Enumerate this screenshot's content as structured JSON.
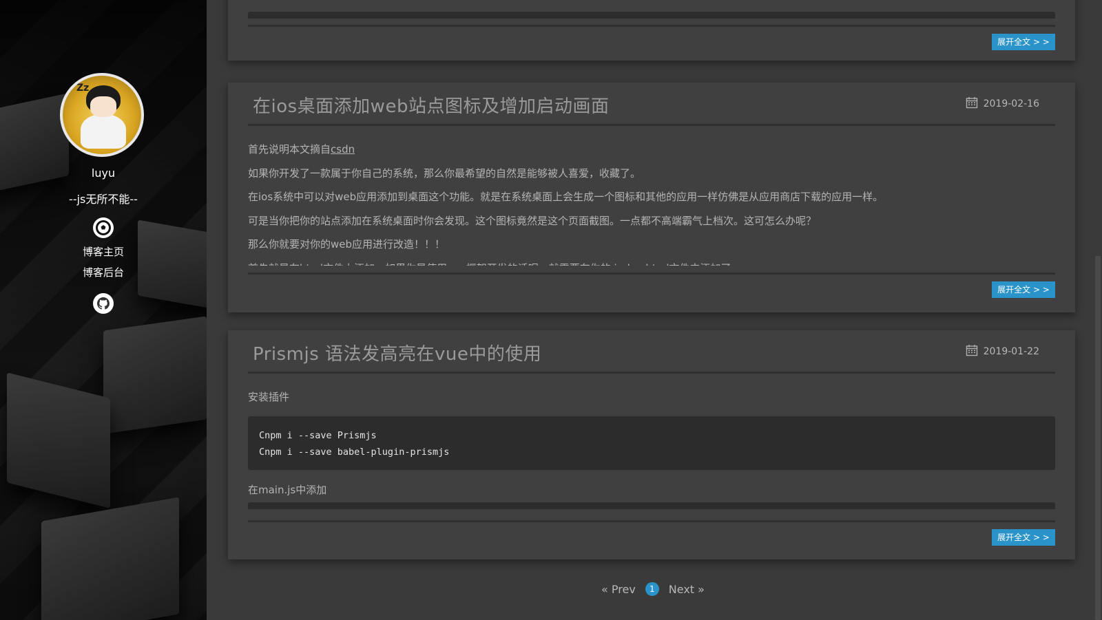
{
  "sidebar": {
    "name": "luyu",
    "motto": "--js无所不能--",
    "links": [
      {
        "label": "博客主页"
      },
      {
        "label": "博客后台"
      }
    ],
    "icons": [
      "soccer-ball-icon",
      "github-icon"
    ]
  },
  "top_card": {
    "more_label": "展开全文 > >"
  },
  "posts": [
    {
      "title": "在ios桌面添加web站点图标及增加启动画面",
      "date": "2019-02-16",
      "intro_prefix": "首先说明本文摘自",
      "intro_link": "csdn",
      "paragraphs": [
        "如果你开发了一款属于你自己的系统，那么你最希望的自然是能够被人喜爱，收藏了。",
        "在ios系统中可以对web应用添加到桌面这个功能。就是在系统桌面上会生成一个图标和其他的应用一样仿佛是从应用商店下载的应用一样。",
        "可是当你把你的站点添加在系统桌面时你会发现。这个图标竟然是这个页面截图。一点都不高端霸气上档次。这可怎么办呢？",
        "那么你就要对你的web应用进行改造！！！",
        "首先就是在html文件上添加，如果你是使用vue框架开发的话呢，就需要在你的 index.html文件中添加了"
      ],
      "more_label": "展开全文 > >"
    },
    {
      "title": "Prismjs 语法发高亮在vue中的使用",
      "date": "2019-01-22",
      "p1": "安装插件",
      "code": [
        "Cnpm i --save Prismjs",
        "Cnpm i --save babel-plugin-prismjs"
      ],
      "p2": "在main.js中添加",
      "more_label": "展开全文 > >"
    }
  ],
  "pagination": {
    "prev": "« Prev",
    "current": "1",
    "next": "Next »"
  },
  "colors": {
    "accent": "#2a93c9",
    "card": "#404040",
    "page_bg": "#3a3a3a"
  }
}
